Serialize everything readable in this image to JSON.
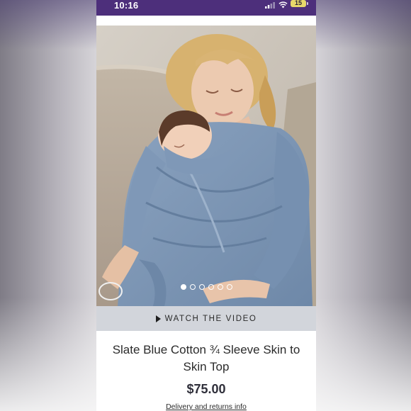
{
  "status_bar": {
    "time": "10:16",
    "battery": "15",
    "icons": [
      "signal-icon",
      "wifi-icon",
      "battery-icon"
    ]
  },
  "product": {
    "image": {
      "icon": "product-photo",
      "carousel_count": 6,
      "active_index": 0
    },
    "video_label": "WATCH THE VIDEO",
    "title": "Slate Blue Cotton ¾ Sleeve Skin to Skin Top",
    "price": "$75.00",
    "delivery_link": "Delivery and returns info"
  },
  "colors": {
    "status_bar": "#4d2f7b",
    "video_bar": "#d2d5db",
    "garment": "#7d97b5"
  }
}
